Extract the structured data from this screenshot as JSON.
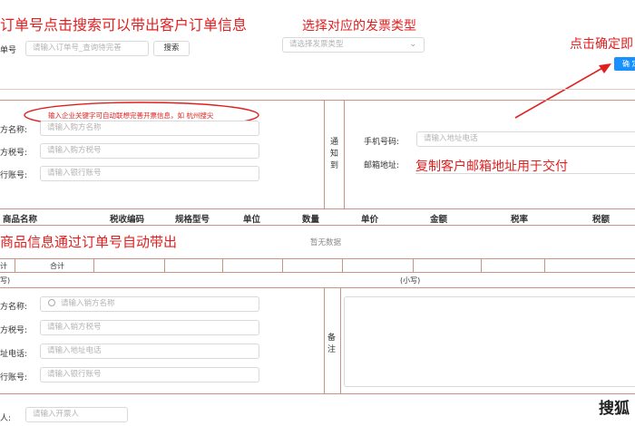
{
  "annotations": {
    "order_search_tip": "订单号点击搜索可以带出客户订单信息",
    "invoice_type_tip": "选择对应的发票类型",
    "confirm_tip": "点击确定即",
    "email_tip": "复制客户邮箱地址用于交付",
    "goods_tip": "商品信息通过订单号自动带出",
    "company_search_tip": "输入企业关键字可自动联想完善开票信息，如 杭州搜尖"
  },
  "order": {
    "label": "单号",
    "placeholder": "请输入订单号_查询待完善",
    "search_button": "搜索"
  },
  "invoice_type": {
    "placeholder": "请选择发票类型"
  },
  "confirm_button": "确 定",
  "buyer": {
    "name_label": "方名称:",
    "name_placeholder": "请输入购方名称",
    "tax_label": "方税号:",
    "tax_placeholder": "请输入购方税号",
    "account_label": "行账号:",
    "account_placeholder": "请输入银行账号"
  },
  "notify": {
    "section_label": "通知到",
    "phone_label": "手机号码:",
    "phone_placeholder": "请输入地址电话",
    "email_label": "邮箱地址:"
  },
  "goods_table": {
    "headers": [
      "商品名称",
      "税收编码",
      "规格型号",
      "单位",
      "数量",
      "单价",
      "金额",
      "税率",
      "税额"
    ],
    "empty_text": "暂无数据",
    "left_cut_label": "计",
    "total_label": "合计",
    "bracket_left": "写)",
    "small_write": "(小写)"
  },
  "seller": {
    "name_label": "方名称:",
    "name_placeholder": "请输入销方名称",
    "tax_label": "方税号:",
    "tax_placeholder": "请输入销方税号",
    "address_label": "址电话:",
    "address_placeholder": "请输入地址电话",
    "account_label": "行账号:",
    "account_placeholder": "请输入银行账号",
    "remark_label": "备注"
  },
  "drawer": {
    "label": "人:",
    "placeholder": "请输入开票人"
  },
  "watermark": "搜狐",
  "colors": {
    "annotation_red": "#e02020",
    "table_border": "#c89484",
    "confirm_blue": "#1890ff"
  }
}
